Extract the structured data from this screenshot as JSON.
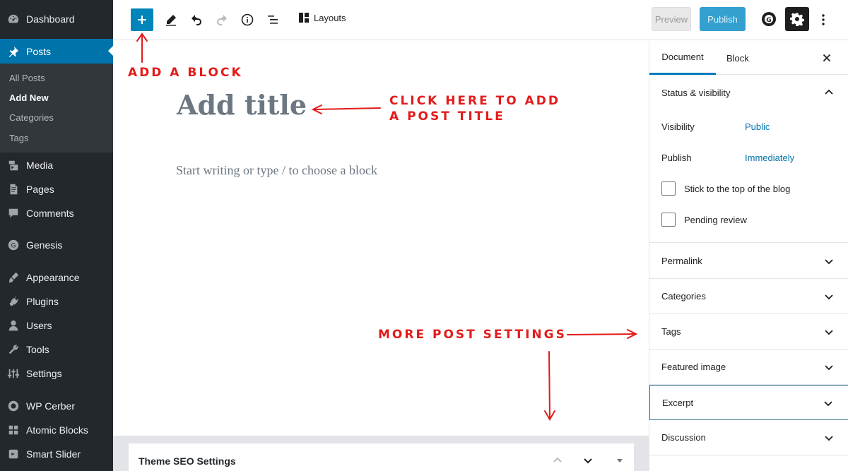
{
  "admin_menu": {
    "items": [
      {
        "label": "Dashboard",
        "icon": "dashboard-icon"
      },
      {
        "label": "Posts",
        "icon": "pin-icon"
      },
      {
        "label": "Media",
        "icon": "media-icon"
      },
      {
        "label": "Pages",
        "icon": "pages-icon"
      },
      {
        "label": "Comments",
        "icon": "comments-icon"
      },
      {
        "label": "Genesis",
        "icon": "genesis-icon"
      },
      {
        "label": "Appearance",
        "icon": "brush-icon"
      },
      {
        "label": "Plugins",
        "icon": "plugin-icon"
      },
      {
        "label": "Users",
        "icon": "users-icon"
      },
      {
        "label": "Tools",
        "icon": "wrench-icon"
      },
      {
        "label": "Settings",
        "icon": "settings-sliders-icon"
      },
      {
        "label": "WP Cerber",
        "icon": "cerber-icon"
      },
      {
        "label": "Atomic Blocks",
        "icon": "grid-icon"
      },
      {
        "label": "Smart Slider",
        "icon": "slider-icon"
      }
    ],
    "submenu": [
      "All Posts",
      "Add New",
      "Categories",
      "Tags"
    ]
  },
  "toolbar": {
    "layouts_label": "Layouts",
    "preview_label": "Preview",
    "publish_label": "Publish"
  },
  "editor": {
    "title_placeholder": "Add title",
    "appender_placeholder": "Start writing or type / to choose a block"
  },
  "metabox": {
    "title": "Theme SEO Settings"
  },
  "sidebar": {
    "tabs": [
      "Document",
      "Block"
    ],
    "status_panel": {
      "title": "Status & visibility",
      "visibility_label": "Visibility",
      "visibility_value": "Public",
      "publish_label": "Publish",
      "publish_value": "Immediately",
      "stick_label": "Stick to the top of the blog",
      "pending_label": "Pending review"
    },
    "panels": [
      "Permalink",
      "Categories",
      "Tags",
      "Featured image",
      "Excerpt",
      "Discussion"
    ]
  },
  "annotations": {
    "add_block": "ADD A BLOCK",
    "title_line1": "CLICK HERE TO ADD",
    "title_line2": "A POST TITLE",
    "more_settings": "MORE POST SETTINGS"
  },
  "colors": {
    "accent": "#0085ba",
    "admin_bar": "#23282d",
    "annotation": "#e31b1b"
  }
}
